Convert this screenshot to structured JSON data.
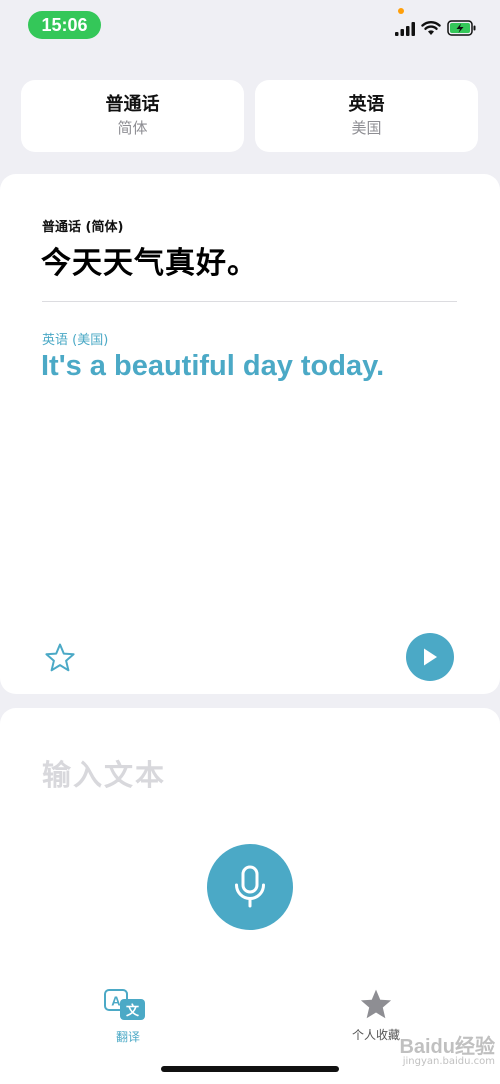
{
  "status_bar": {
    "time": "15:06",
    "indicator_dot_color": "#ff9f0a",
    "time_pill_color": "#34c759"
  },
  "language_selector": {
    "source": {
      "name": "普通话",
      "variant": "简体"
    },
    "target": {
      "name": "英语",
      "variant": "美国"
    }
  },
  "translation": {
    "source_label": "普通话 (简体)",
    "source_text": "今天天气真好。",
    "target_label": "英语 (美国)",
    "target_text": "It's a beautiful day today.",
    "favorite_icon": "star-outline-icon",
    "play_icon": "play-icon"
  },
  "input": {
    "placeholder": "输入文本",
    "mic_icon": "microphone-icon"
  },
  "tab_bar": {
    "tabs": [
      {
        "label": "翻译",
        "icon": "translate-icon",
        "active": true
      },
      {
        "label": "个人收藏",
        "icon": "star-icon",
        "active": false
      }
    ]
  },
  "watermark": {
    "text": "Baidu经验",
    "sub": "jingyan.baidu.com"
  },
  "colors": {
    "accent": "#4ba9c6",
    "background": "#efeff4",
    "card": "#ffffff",
    "placeholder": "#d8d8dc"
  }
}
